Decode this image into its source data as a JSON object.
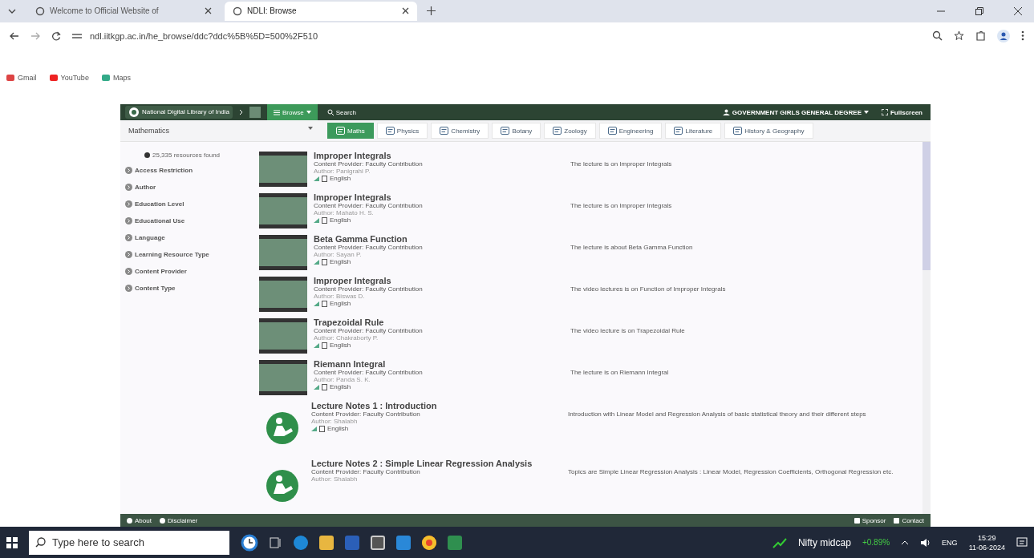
{
  "browser": {
    "tabs": [
      {
        "title": "Welcome to Official Website of",
        "selected": false
      },
      {
        "title": "NDLI: Browse",
        "selected": true
      }
    ],
    "url": "ndl.iitkgp.ac.in/he_browse/ddc?ddc%5B%5D=500%2F510",
    "bookmarks": [
      {
        "label": "Gmail"
      },
      {
        "label": "YouTube"
      },
      {
        "label": "Maps"
      }
    ]
  },
  "header": {
    "logo": "National Digital Library of India",
    "browse": "Browse",
    "search": "Search",
    "institution": "GOVERNMENT GIRLS GENERAL DEGREE",
    "fullscreen": "Fullscreen"
  },
  "subject_select": "Mathematics",
  "subject_tabs": [
    {
      "label": "Maths",
      "selected": true
    },
    {
      "label": "Physics",
      "selected": false
    },
    {
      "label": "Chemistry",
      "selected": false
    },
    {
      "label": "Botany",
      "selected": false
    },
    {
      "label": "Zoology",
      "selected": false
    },
    {
      "label": "Engineering",
      "selected": false
    },
    {
      "label": "Literature",
      "selected": false
    },
    {
      "label": "History & Geography",
      "selected": false
    }
  ],
  "filters": {
    "count": "25,335 resources found",
    "items": [
      "Access Restriction",
      "Author",
      "Education Level",
      "Educational Use",
      "Language",
      "Learning Resource Type",
      "Content Provider",
      "Content Type"
    ]
  },
  "results": [
    {
      "kind": "video",
      "title": "Improper Integrals",
      "provider": "Content Provider: Faculty Contribution",
      "author": "Author: Panigrahi P.",
      "language": "English",
      "description": "The lecture is on Improper Integrals"
    },
    {
      "kind": "video",
      "title": "Improper Integrals",
      "provider": "Content Provider: Faculty Contribution",
      "author": "Author: Mahato H. S.",
      "language": "English",
      "description": "The lecture is on Improper Integrals"
    },
    {
      "kind": "video",
      "title": "Beta Gamma Function",
      "provider": "Content Provider: Faculty Contribution",
      "author": "Author: Sayan P.",
      "language": "English",
      "description": "The lecture is about Beta Gamma Function"
    },
    {
      "kind": "video",
      "title": "Improper Integrals",
      "provider": "Content Provider: Faculty Contribution",
      "author": "Author: Biswas D.",
      "language": "English",
      "description": "The video lectures is on Function of Improper Integrals"
    },
    {
      "kind": "video",
      "title": "Trapezoidal Rule",
      "provider": "Content Provider: Faculty Contribution",
      "author": "Author: Chakraborty P.",
      "language": "English",
      "description": "The video lecture is on Trapezoidal Rule"
    },
    {
      "kind": "video",
      "title": "Riemann Integral",
      "provider": "Content Provider: Faculty Contribution",
      "author": "Author: Panda S. K.",
      "language": "English",
      "description": "The lecture is on Riemann Integral"
    },
    {
      "kind": "notes",
      "title": "Lecture Notes 1 : Introduction",
      "provider": "Content Provider: Faculty Contribution",
      "author": "Author: Shalabh",
      "language": "English",
      "description": "Introduction with Linear Model and Regression Analysis of basic statistical theory and their different steps"
    },
    {
      "kind": "notes",
      "title": "Lecture Notes 2 : Simple Linear Regression Analysis",
      "provider": "Content Provider: Faculty Contribution",
      "author": "Author: Shalabh",
      "description": "Topics are Simple Linear Regression Analysis : Linear Model, Regression Coefficients, Orthogonal Regression etc."
    }
  ],
  "footer": {
    "left": [
      "About",
      "Disclaimer"
    ],
    "right": [
      "Sponsor",
      "Contact"
    ]
  },
  "taskbar": {
    "search_placeholder": "Type here to search",
    "news": "Nifty midcap",
    "change": "+0.89%",
    "language": "ENG",
    "time": "15:29",
    "date": "11-06-2024"
  }
}
